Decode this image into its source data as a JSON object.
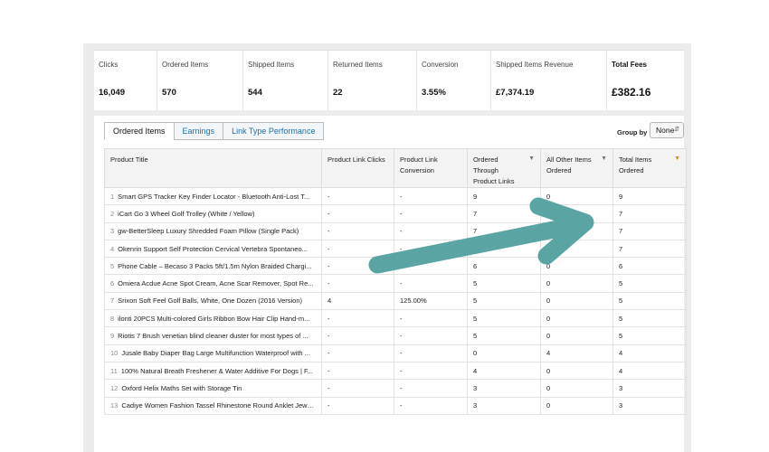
{
  "stats": [
    {
      "label": "Clicks",
      "value": "16,049"
    },
    {
      "label": "Ordered Items",
      "value": "570"
    },
    {
      "label": "Shipped Items",
      "value": "544"
    },
    {
      "label": "Returned Items",
      "value": "22"
    },
    {
      "label": "Conversion",
      "value": "3.55%"
    },
    {
      "label": "Shipped Items Revenue",
      "value": "£7,374.19"
    },
    {
      "label": "Total Fees",
      "value": "£382.16"
    }
  ],
  "tabs": [
    "Ordered Items",
    "Earnings",
    "Link Type Performance"
  ],
  "group_by": {
    "label": "Group by",
    "value": "None"
  },
  "columns": [
    "Product Title",
    "Product Link Clicks",
    "Product Link Conversion",
    "Ordered Through Product Links",
    "All Other Items Ordered",
    "Total Items Ordered"
  ],
  "rows": [
    {
      "n": "1",
      "title": "Smart GPS Tracker Key Finder Locator - Bluetooth Anti-Lost T...",
      "clicks": "-",
      "conv": "-",
      "ordered": "9",
      "other": "0",
      "total": "9"
    },
    {
      "n": "2",
      "title": "iCart Go 3 Wheel Golf Trolley (White / Yellow)",
      "clicks": "-",
      "conv": "-",
      "ordered": "7",
      "other": "0",
      "total": "7"
    },
    {
      "n": "3",
      "title": "gw-BetterSleep Luxury Shredded Foam Pillow (Single Pack)",
      "clicks": "-",
      "conv": "-",
      "ordered": "7",
      "other": "0",
      "total": "7"
    },
    {
      "n": "4",
      "title": "Okenrin Support Self Protection Cervical Vertebra Spontaneo...",
      "clicks": "-",
      "conv": "-",
      "ordered": "7",
      "other": "0",
      "total": "7"
    },
    {
      "n": "5",
      "title": "Phone Cable – Becaso 3 Packs 5ft/1.5m Nylon Braided Chargi...",
      "clicks": "-",
      "conv": "-",
      "ordered": "6",
      "other": "0",
      "total": "6"
    },
    {
      "n": "6",
      "title": "Omiera Acdue Acne Spot Cream, Acne Scar Remover, Spot Re...",
      "clicks": "-",
      "conv": "-",
      "ordered": "5",
      "other": "0",
      "total": "5"
    },
    {
      "n": "7",
      "title": "Srixon Soft Feel Golf Balls, White, One Dozen (2016 Version)",
      "clicks": "4",
      "conv": "125.00%",
      "ordered": "5",
      "other": "0",
      "total": "5"
    },
    {
      "n": "8",
      "title": "ilonti 20PCS Multi-colored Girls Ribbon Bow Hair Clip Hand-m...",
      "clicks": "-",
      "conv": "-",
      "ordered": "5",
      "other": "0",
      "total": "5"
    },
    {
      "n": "9",
      "title": "Riotis 7 Brush venetian blind cleaner duster for most types of ...",
      "clicks": "-",
      "conv": "-",
      "ordered": "5",
      "other": "0",
      "total": "5"
    },
    {
      "n": "10",
      "title": "Jusale Baby Diaper Bag Large Multifunction Waterproof with ...",
      "clicks": "-",
      "conv": "-",
      "ordered": "0",
      "other": "4",
      "total": "4"
    },
    {
      "n": "11",
      "title": "100% Natural Breath Freshener & Water Additive For Dogs | F...",
      "clicks": "-",
      "conv": "-",
      "ordered": "4",
      "other": "0",
      "total": "4"
    },
    {
      "n": "12",
      "title": "Oxford Helix Maths Set with Storage Tin",
      "clicks": "-",
      "conv": "-",
      "ordered": "3",
      "other": "0",
      "total": "3"
    },
    {
      "n": "13",
      "title": "Cadiye Women Fashion Tassel Rhinestone Round Anklet Jewe...",
      "clicks": "-",
      "conv": "-",
      "ordered": "3",
      "other": "0",
      "total": "3"
    }
  ],
  "colors": {
    "arrow": "#5aa5a4",
    "sort_active": "#e48b1a",
    "tab_link": "#1d6fa5"
  }
}
